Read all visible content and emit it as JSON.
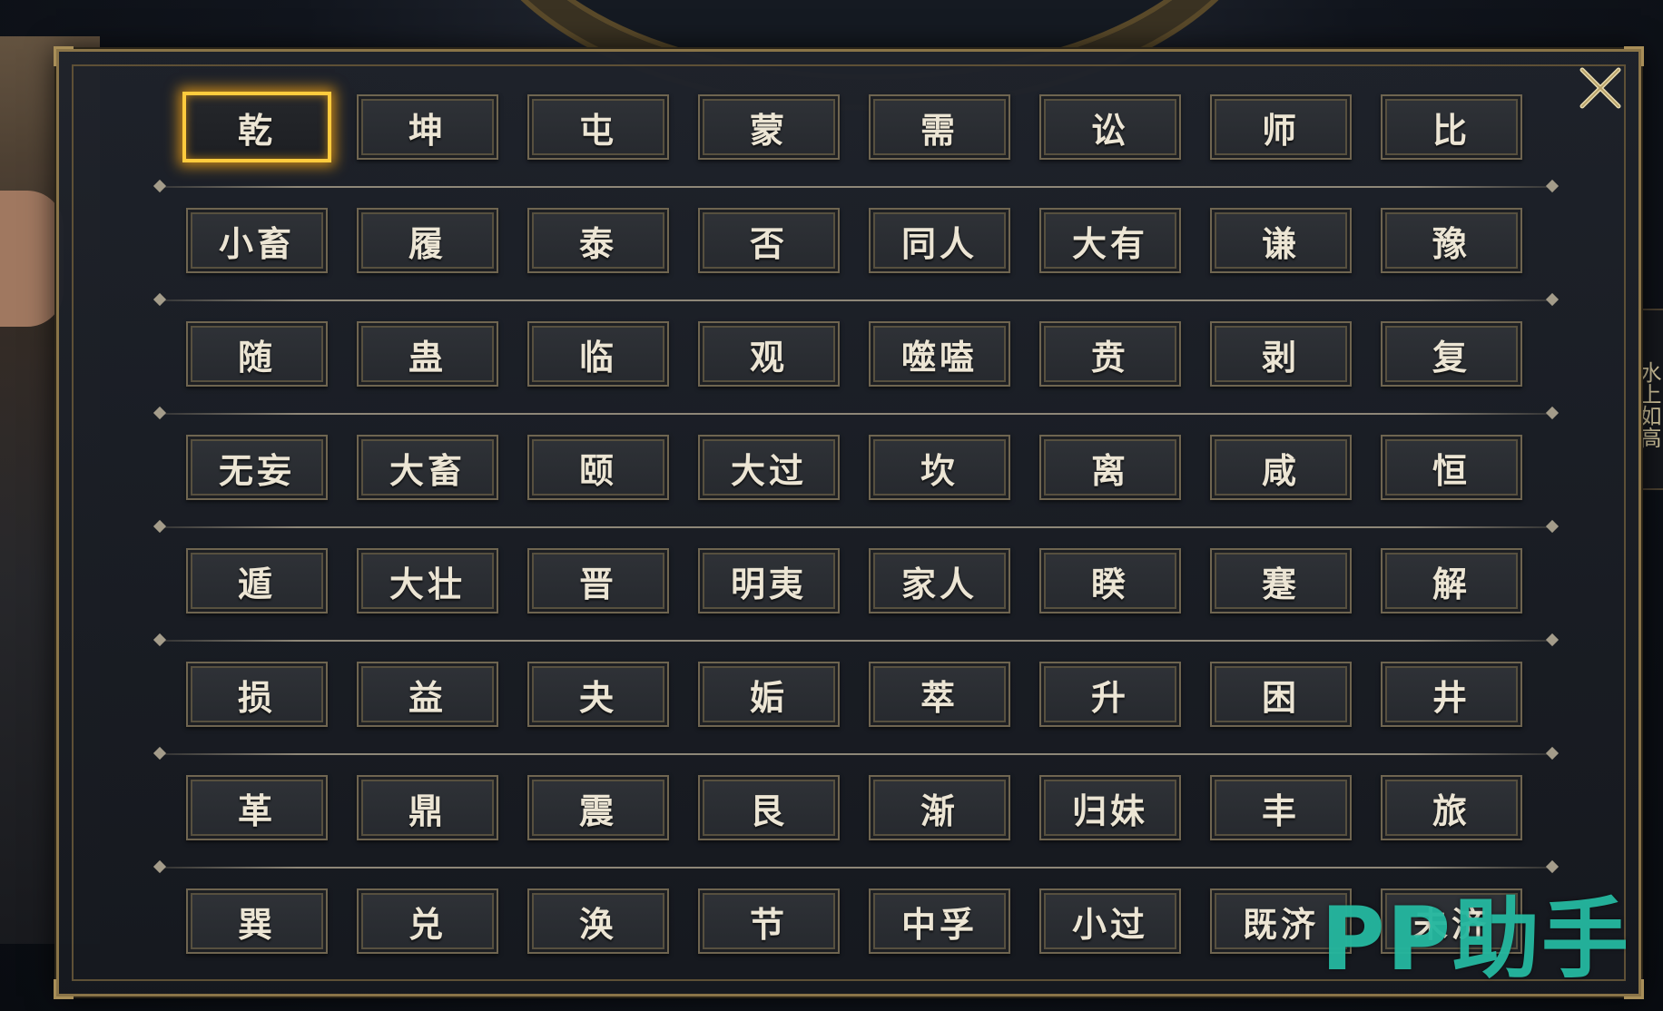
{
  "side_tab_text": "水上如高",
  "close_icon": "close-x-icon",
  "selected_hexagram": "乾",
  "hexagram_rows": [
    [
      "乾",
      "坤",
      "屯",
      "蒙",
      "需",
      "讼",
      "师",
      "比"
    ],
    [
      "小畜",
      "履",
      "泰",
      "否",
      "同人",
      "大有",
      "谦",
      "豫"
    ],
    [
      "随",
      "蛊",
      "临",
      "观",
      "噬嗑",
      "贲",
      "剥",
      "复"
    ],
    [
      "无妄",
      "大畜",
      "颐",
      "大过",
      "坎",
      "离",
      "咸",
      "恒"
    ],
    [
      "遁",
      "大壮",
      "晋",
      "明夷",
      "家人",
      "睽",
      "蹇",
      "解"
    ],
    [
      "损",
      "益",
      "夬",
      "姤",
      "萃",
      "升",
      "困",
      "井"
    ],
    [
      "革",
      "鼎",
      "震",
      "艮",
      "渐",
      "归妹",
      "丰",
      "旅"
    ],
    [
      "巽",
      "兑",
      "涣",
      "节",
      "中孚",
      "小过",
      "既济",
      "未济"
    ]
  ],
  "watermark": "PP助手",
  "colors": {
    "accent_gold": "#ffcb3d",
    "panel_border": "#8a7448",
    "button_text": "#ece5d4",
    "watermark": "#26bea5"
  }
}
